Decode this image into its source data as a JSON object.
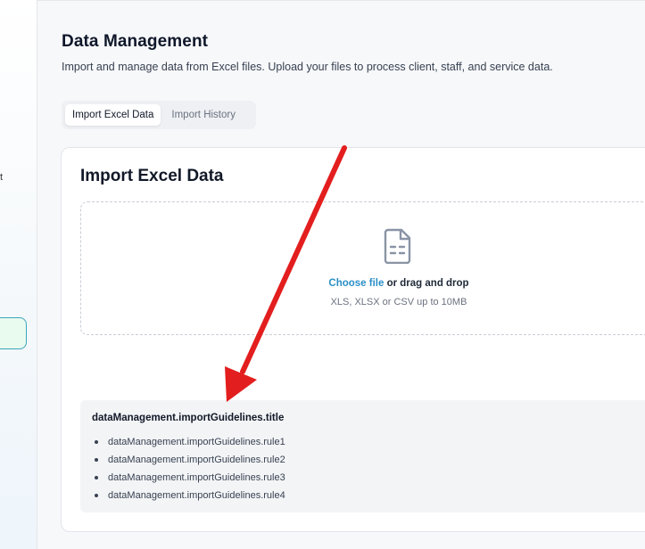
{
  "sidebar": {
    "fragment_text": "t"
  },
  "header": {
    "title": "Data Management",
    "subtitle": "Import and manage data from Excel files. Upload your files to process client, staff, and service data."
  },
  "tabs": [
    {
      "label": "Import Excel Data",
      "active": true
    },
    {
      "label": "Import History",
      "active": false
    }
  ],
  "card": {
    "title": "Import Excel Data",
    "dropzone": {
      "icon": "file-spreadsheet-icon",
      "choose_label": "Choose file",
      "drag_label": " or drag and drop",
      "hint": "XLS, XLSX or CSV up to 10MB"
    },
    "guidelines": {
      "title": "dataManagement.importGuidelines.title",
      "rules": [
        "dataManagement.importGuidelines.rule1",
        "dataManagement.importGuidelines.rule2",
        "dataManagement.importGuidelines.rule3",
        "dataManagement.importGuidelines.rule4"
      ]
    }
  },
  "annotation": {
    "arrow_color": "#e31e1e"
  },
  "colors": {
    "accent": "#2b8fc7",
    "active_nav_border": "#3aa6b9",
    "active_nav_bg": "#e9fbef"
  }
}
